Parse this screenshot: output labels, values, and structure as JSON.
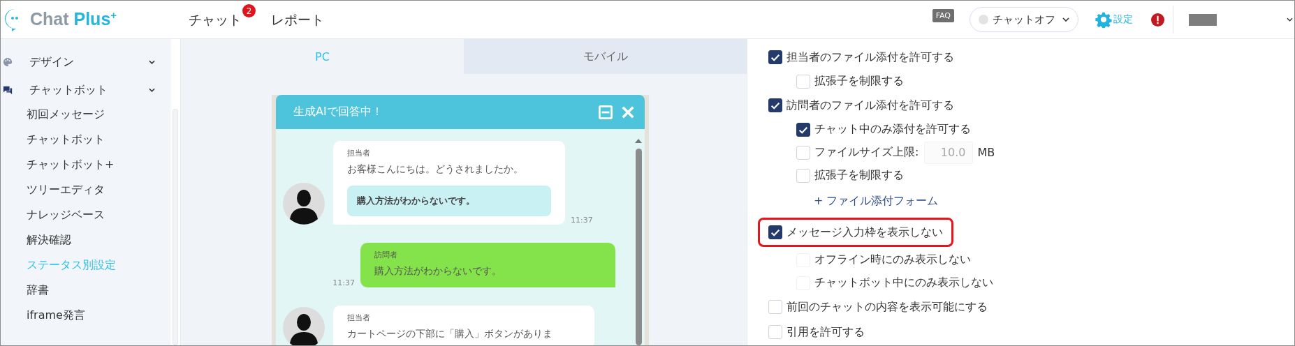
{
  "header": {
    "logo": {
      "text": "Chat",
      "accent": "Plus",
      "mark": "+"
    },
    "nav": [
      {
        "label": "チャット",
        "badge": "2",
        "selected": false
      },
      {
        "label": "レポート",
        "selected": false
      }
    ],
    "faq": "FAQ",
    "status": {
      "label": "チャットオフ",
      "on": false
    },
    "settings": "設定",
    "alert": true
  },
  "sidebar": {
    "sections": [
      {
        "label": "デザイン",
        "kind": "design"
      },
      {
        "label": "チャットボット",
        "kind": "bot",
        "items": [
          {
            "label": "初回メッセージ",
            "selected": false
          },
          {
            "label": "チャットボット",
            "selected": false
          },
          {
            "label": "チャットボット+",
            "selected": false
          },
          {
            "label": "ツリーエディタ",
            "selected": false
          },
          {
            "label": "ナレッジベース",
            "selected": false
          },
          {
            "label": "解決確認",
            "selected": false
          },
          {
            "label": "ステータス別設定",
            "selected": true
          },
          {
            "label": "辞書",
            "selected": false
          },
          {
            "label": "iframe発言",
            "selected": false
          }
        ]
      }
    ]
  },
  "preview": {
    "tabs": [
      {
        "label": "PC",
        "selected": true
      },
      {
        "label": "モバイル",
        "selected": false
      }
    ],
    "widget": {
      "title": "生成AIで回答中！",
      "messages": [
        {
          "kind": "agent",
          "sender": "担当者",
          "text": "お客様こんにちは。どうされましたか。",
          "choice": "購入方法がわからないです。",
          "time": "11:37"
        },
        {
          "kind": "visitor",
          "sender": "訪問者",
          "text": "購入方法がわからないです。",
          "time": "11:37"
        },
        {
          "kind": "agent",
          "sender": "担当者",
          "text": "カートページの下部に「購入」ボタンがありま"
        }
      ]
    }
  },
  "settings": [
    {
      "kind": "checkbox",
      "label": "担当者のファイル添付を許可する",
      "checked": true,
      "children": [
        {
          "kind": "checkbox",
          "label": "拡張子を制限する",
          "checked": false
        }
      ]
    },
    {
      "kind": "checkbox",
      "label": "訪問者のファイル添付を許可する",
      "checked": true,
      "children": [
        {
          "kind": "checkbox",
          "label": "チャット中のみ添付を許可する",
          "checked": true
        },
        {
          "kind": "size",
          "label": "ファイルサイズ上限:",
          "checked": false,
          "value": "10.0",
          "unit": "MB"
        },
        {
          "kind": "checkbox",
          "label": "拡張子を制限する",
          "checked": false
        },
        {
          "kind": "link",
          "label": "+ ファイル添付フォーム"
        }
      ]
    },
    {
      "kind": "checkbox",
      "label": "メッセージ入力枠を表示しない",
      "checked": true,
      "highlighted": true,
      "children": [
        {
          "kind": "checkbox",
          "label": "オフライン時にのみ表示しない",
          "checked": false,
          "disabled": true
        },
        {
          "kind": "checkbox",
          "label": "チャットボット中にのみ表示しない",
          "checked": false,
          "disabled": true
        }
      ]
    },
    {
      "kind": "checkbox",
      "label": "前回のチャットの内容を表示可能にする",
      "checked": false
    },
    {
      "kind": "checkbox",
      "label": "引用を許可する",
      "checked": false
    }
  ]
}
